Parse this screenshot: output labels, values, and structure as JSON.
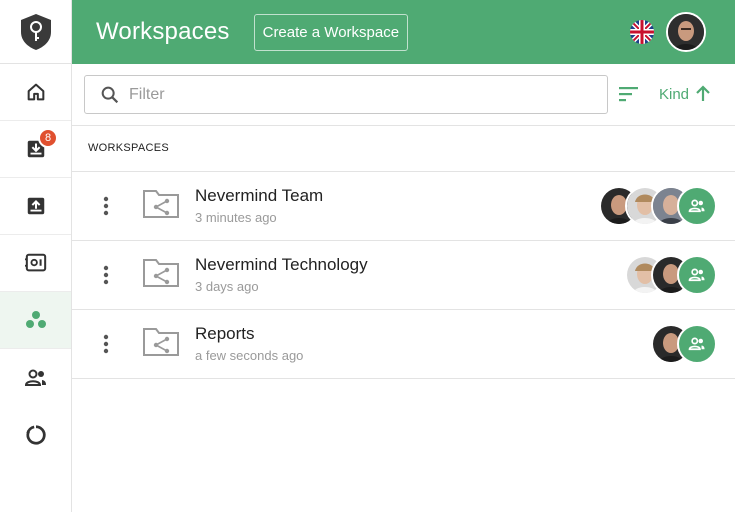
{
  "header": {
    "title": "Workspaces",
    "create_label": "Create a Workspace",
    "accent": "#4faa73"
  },
  "sidebar": {
    "items": [
      {
        "icon": "home-icon",
        "badge": ""
      },
      {
        "icon": "inbox-download-icon",
        "badge": "8"
      },
      {
        "icon": "outbox-upload-icon",
        "badge": ""
      },
      {
        "icon": "safe-icon",
        "badge": ""
      },
      {
        "icon": "workspaces-dots-icon",
        "badge": ""
      },
      {
        "icon": "people-icon",
        "badge": ""
      },
      {
        "icon": "circle-progress-icon",
        "badge": ""
      }
    ]
  },
  "filter": {
    "placeholder": "Filter",
    "value": "",
    "sort_label": "Kind"
  },
  "section_label": "WORKSPACES",
  "workspaces": [
    {
      "name": "Nevermind Team",
      "time": "3 minutes ago",
      "members": 3
    },
    {
      "name": "Nevermind Technology",
      "time": "3 days ago",
      "members": 2
    },
    {
      "name": "Reports",
      "time": "a few seconds ago",
      "members": 1
    }
  ]
}
